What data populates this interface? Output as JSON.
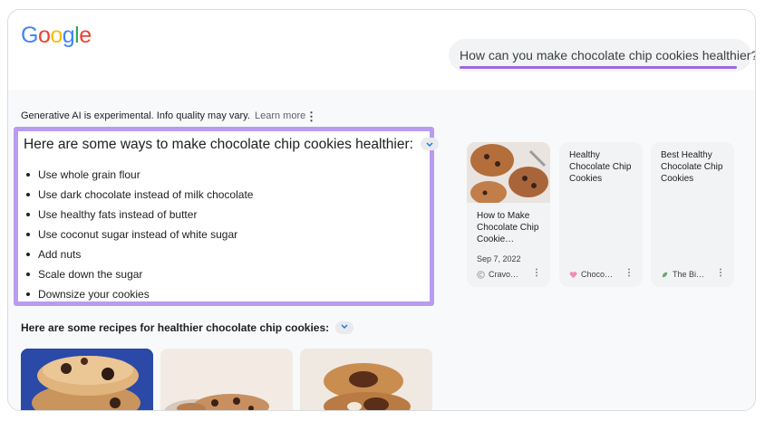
{
  "logo": {
    "letters": [
      "G",
      "o",
      "o",
      "g",
      "l",
      "e"
    ],
    "colors": [
      "#4285F4",
      "#EA4335",
      "#FBBC05",
      "#4285F4",
      "#34A853",
      "#EA4335"
    ]
  },
  "search": {
    "query": "How can you make chocolate chip cookies healthier?"
  },
  "ai": {
    "disclaimer": "Generative AI is experimental. Info quality may vary.",
    "learn_more": "Learn more",
    "kebab": "⋮",
    "heading": "Here are some ways to make chocolate chip cookies healthier:",
    "bullets": [
      "Use whole grain flour",
      "Use dark chocolate instead of milk chocolate",
      "Use healthy fats instead of butter",
      "Use coconut sugar instead of white sugar",
      "Add nuts",
      "Scale down the sugar",
      "Downsize your cookies"
    ],
    "recipes_heading": "Here are some recipes for healthier chocolate chip cookies:"
  },
  "cards": [
    {
      "title": "How to Make Chocolate Chip Cookie…",
      "date": "Sep 7, 2022",
      "source": "Cravo…",
      "icon": "cravings-icon"
    },
    {
      "title": "Healthy Chocolate Chip Cookies",
      "source": "Choco…",
      "icon": "heart-icon"
    },
    {
      "title": "Best Healthy Chocolate Chip Cookies",
      "source": "The Bi…",
      "icon": "leaf-icon"
    }
  ],
  "colors": {
    "accent": "#9c6ade",
    "highlight_border": "#b99cf0"
  }
}
